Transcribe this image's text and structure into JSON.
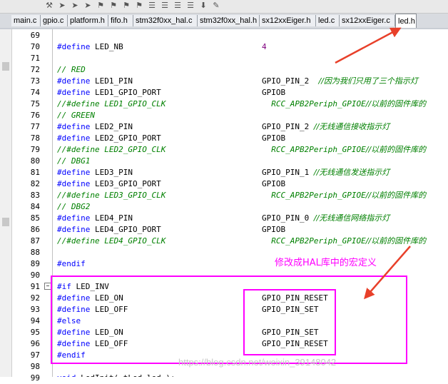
{
  "tabs": [
    {
      "label": "main.c"
    },
    {
      "label": "gpio.c"
    },
    {
      "label": "platform.h"
    },
    {
      "label": "fifo.h"
    },
    {
      "label": "stm32f0xx_hal.c"
    },
    {
      "label": "stm32f0xx_hal.h"
    },
    {
      "label": "sx12xxEiger.h"
    },
    {
      "label": "led.c"
    },
    {
      "label": "sx12xxEiger.c"
    },
    {
      "label": "led.h"
    }
  ],
  "active_tab": "led.h",
  "toolbar_icons": [
    "tool-icon",
    "arrow-icon",
    "arrow-icon",
    "arrow-icon",
    "bookmark-icon",
    "bookmark-icon",
    "bookmark-icon",
    "bookmark-icon",
    "list-icon",
    "list-icon",
    "list-icon",
    "list-icon",
    "download-icon",
    "edit-icon"
  ],
  "lines": [
    {
      "no": "69",
      "a": "",
      "b": ""
    },
    {
      "no": "70",
      "a": "#define LED_NB",
      "b": "4"
    },
    {
      "no": "71",
      "a": "",
      "b": ""
    },
    {
      "no": "72",
      "a": "// RED",
      "b": ""
    },
    {
      "no": "73",
      "a": "#define LED1_PIN",
      "b": "GPIO_PIN_2  //因为我们只用了三个指示灯"
    },
    {
      "no": "74",
      "a": "#define LED1_GPIO_PORT",
      "b": "GPIOB"
    },
    {
      "no": "75",
      "a": "//#define LED1_GPIO_CLK",
      "b": "  RCC_APB2Periph_GPIOE//以前的固件库的"
    },
    {
      "no": "76",
      "a": "// GREEN",
      "b": ""
    },
    {
      "no": "77",
      "a": "#define LED2_PIN",
      "b": "GPIO_PIN_2 //无线通信接收指示灯"
    },
    {
      "no": "78",
      "a": "#define LED2_GPIO_PORT",
      "b": "GPIOB"
    },
    {
      "no": "79",
      "a": "//#define LED2_GPIO_CLK",
      "b": "  RCC_APB2Periph_GPIOE//以前的固件库的"
    },
    {
      "no": "80",
      "a": "// DBG1",
      "b": ""
    },
    {
      "no": "81",
      "a": "#define LED3_PIN",
      "b": "GPIO_PIN_1 //无线通信发送指示灯"
    },
    {
      "no": "82",
      "a": "#define LED3_GPIO_PORT",
      "b": "GPIOB"
    },
    {
      "no": "83",
      "a": "//#define LED3_GPIO_CLK",
      "b": "  RCC_APB2Periph_GPIOE//以前的固件库的"
    },
    {
      "no": "84",
      "a": "// DBG2",
      "b": ""
    },
    {
      "no": "85",
      "a": "#define LED4_PIN",
      "b": "GPIO_PIN_0 //无线通信网络指示灯"
    },
    {
      "no": "86",
      "a": "#define LED4_GPIO_PORT",
      "b": "GPIOB"
    },
    {
      "no": "87",
      "a": "//#define LED4_GPIO_CLK",
      "b": "  RCC_APB2Periph_GPIOE//以前的固件库的"
    },
    {
      "no": "88",
      "a": "",
      "b": ""
    },
    {
      "no": "89",
      "a": "#endif",
      "b": ""
    },
    {
      "no": "90",
      "a": "",
      "b": ""
    },
    {
      "no": "91",
      "a": "#if LED_INV",
      "b": ""
    },
    {
      "no": "92",
      "a": "#define LED_ON",
      "b": "GPIO_PIN_RESET"
    },
    {
      "no": "93",
      "a": "#define LED_OFF",
      "b": "GPIO_PIN_SET"
    },
    {
      "no": "94",
      "a": "#else",
      "b": ""
    },
    {
      "no": "95",
      "a": "#define LED_ON",
      "b": "GPIO_PIN_SET"
    },
    {
      "no": "96",
      "a": "#define LED_OFF",
      "b": "GPIO_PIN_RESET"
    },
    {
      "no": "97",
      "a": "#endif",
      "b": ""
    },
    {
      "no": "98",
      "a": "",
      "b": ""
    },
    {
      "no": "99",
      "a": "void LedInit( tLed led );",
      "b": ""
    }
  ],
  "annotation": "修改成HAL库中的宏定义",
  "watermark": "https://blog.csdn.net/weixin_39148042",
  "colors": {
    "highlight": "#ff00ff",
    "arrow": "#e8402a",
    "keyword": "#0000ff",
    "comment": "#008000"
  }
}
